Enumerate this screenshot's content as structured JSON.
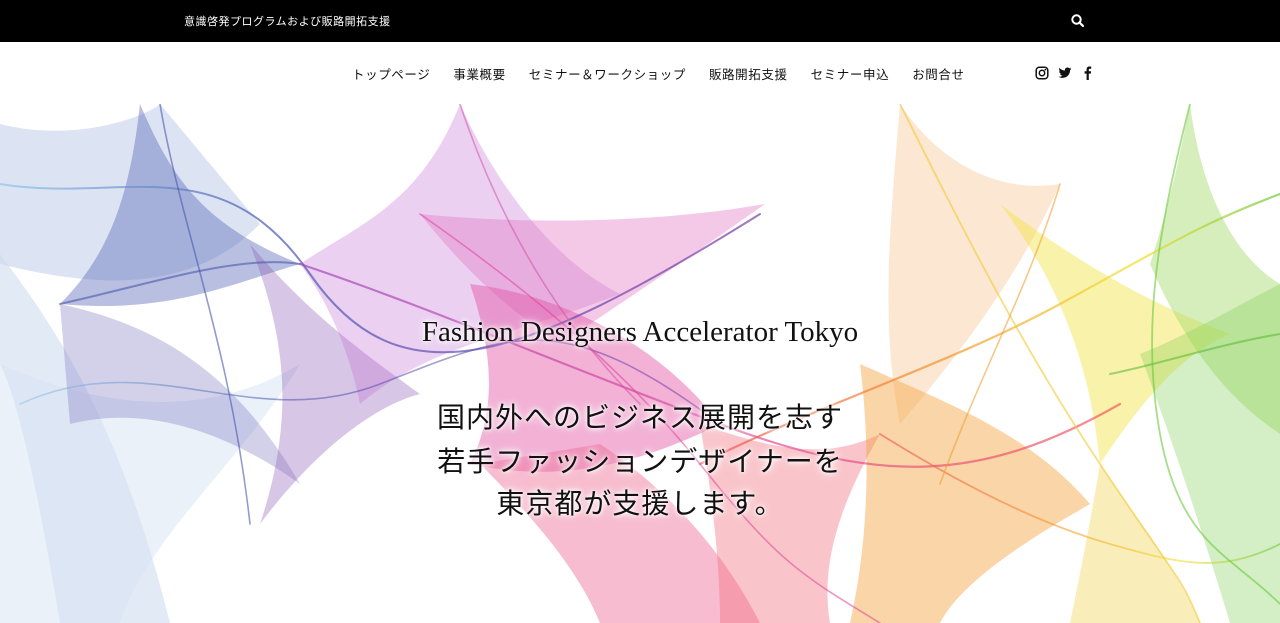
{
  "topbar": {
    "tagline": "意識啓発プログラムおよび販路開拓支援",
    "search_icon": "search-icon",
    "background": "#000000"
  },
  "nav": {
    "items": [
      {
        "label": "トップページ"
      },
      {
        "label": "事業概要"
      },
      {
        "label": "セミナー＆ワークショップ"
      },
      {
        "label": "販路開拓支援"
      },
      {
        "label": "セミナー申込"
      },
      {
        "label": "お問合せ"
      }
    ],
    "social": [
      "instagram-icon",
      "twitter-icon",
      "facebook-icon"
    ]
  },
  "hero": {
    "title_en": "Fashion Designers Accelerator Tokyo",
    "line1": "国内外へのビジネス展開を志す",
    "line2": "若手ファッションデザイナーを",
    "line3": "東京都が支援します。",
    "palette": [
      "#8fc8e8",
      "#4a58b0",
      "#7a3aa8",
      "#e0409a",
      "#f05050",
      "#f39a2a",
      "#f2e030",
      "#6cc83a"
    ]
  }
}
